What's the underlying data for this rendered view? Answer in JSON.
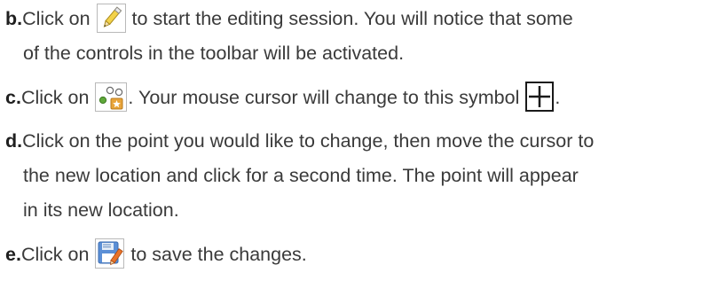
{
  "steps": [
    {
      "letter": "b.",
      "line1_before": "Click on ",
      "line1_after": " to start the editing session. You will notice that some",
      "line2": "of the controls in the toolbar will be activated.",
      "icon": "pencil-edit-icon"
    },
    {
      "letter": "c.",
      "line1_before": "Click on ",
      "line1_middle": ". Your mouse cursor will change to this symbol ",
      "line1_after": ".",
      "icon": "move-vertex-icon",
      "icon2": "crosshair-cursor-icon"
    },
    {
      "letter": "d.",
      "line1": "Click on the point you would like to change, then move the cursor to",
      "line2": "the new location and click for a second time. The point will appear",
      "line3": "in its new location."
    },
    {
      "letter": "e.",
      "line1_before": "Click on ",
      "line1_after": " to save the changes.",
      "icon": "save-edits-icon"
    }
  ],
  "colors": {
    "text": "#3a3a3a",
    "letter": "#1f1f1f",
    "pencil_yellow": "#f3d24a",
    "node_green": "#5fa83a",
    "node_star": "#e8a43a",
    "save_blue": "#5b8fd6",
    "save_pencil": "#e8732a"
  }
}
